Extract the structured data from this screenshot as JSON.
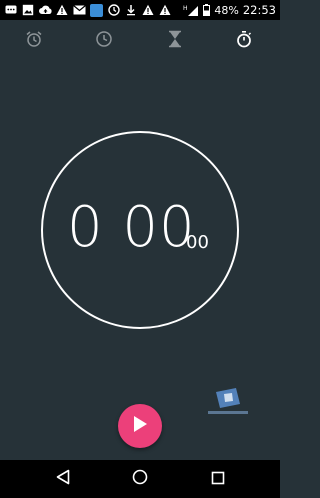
{
  "status_bar": {
    "left_icons": [
      "message-icon",
      "image-icon",
      "cloud-upload-icon",
      "warning-icon",
      "gmail-icon",
      "app-blue-icon",
      "sync-icon",
      "download-icon",
      "warning-icon",
      "warning-icon"
    ],
    "network": "H",
    "battery": "48%",
    "time": "22:53"
  },
  "tabs": [
    {
      "name": "alarm",
      "icon": "alarm-clock-icon",
      "active": false
    },
    {
      "name": "clock",
      "icon": "clock-icon",
      "active": false
    },
    {
      "name": "timer",
      "icon": "hourglass-icon",
      "active": false
    },
    {
      "name": "stopwatch",
      "icon": "stopwatch-icon",
      "active": true
    }
  ],
  "stopwatch": {
    "time": "0 00",
    "hundredths": "00"
  },
  "colors": {
    "background": "#263238",
    "accent": "#ec407a",
    "inactive_icon": "#8d9498",
    "active_icon": "#ffffff"
  },
  "play_button": {
    "icon": "play-icon"
  },
  "nav_bar": {
    "buttons": [
      "back-icon",
      "home-icon",
      "recents-icon"
    ]
  }
}
